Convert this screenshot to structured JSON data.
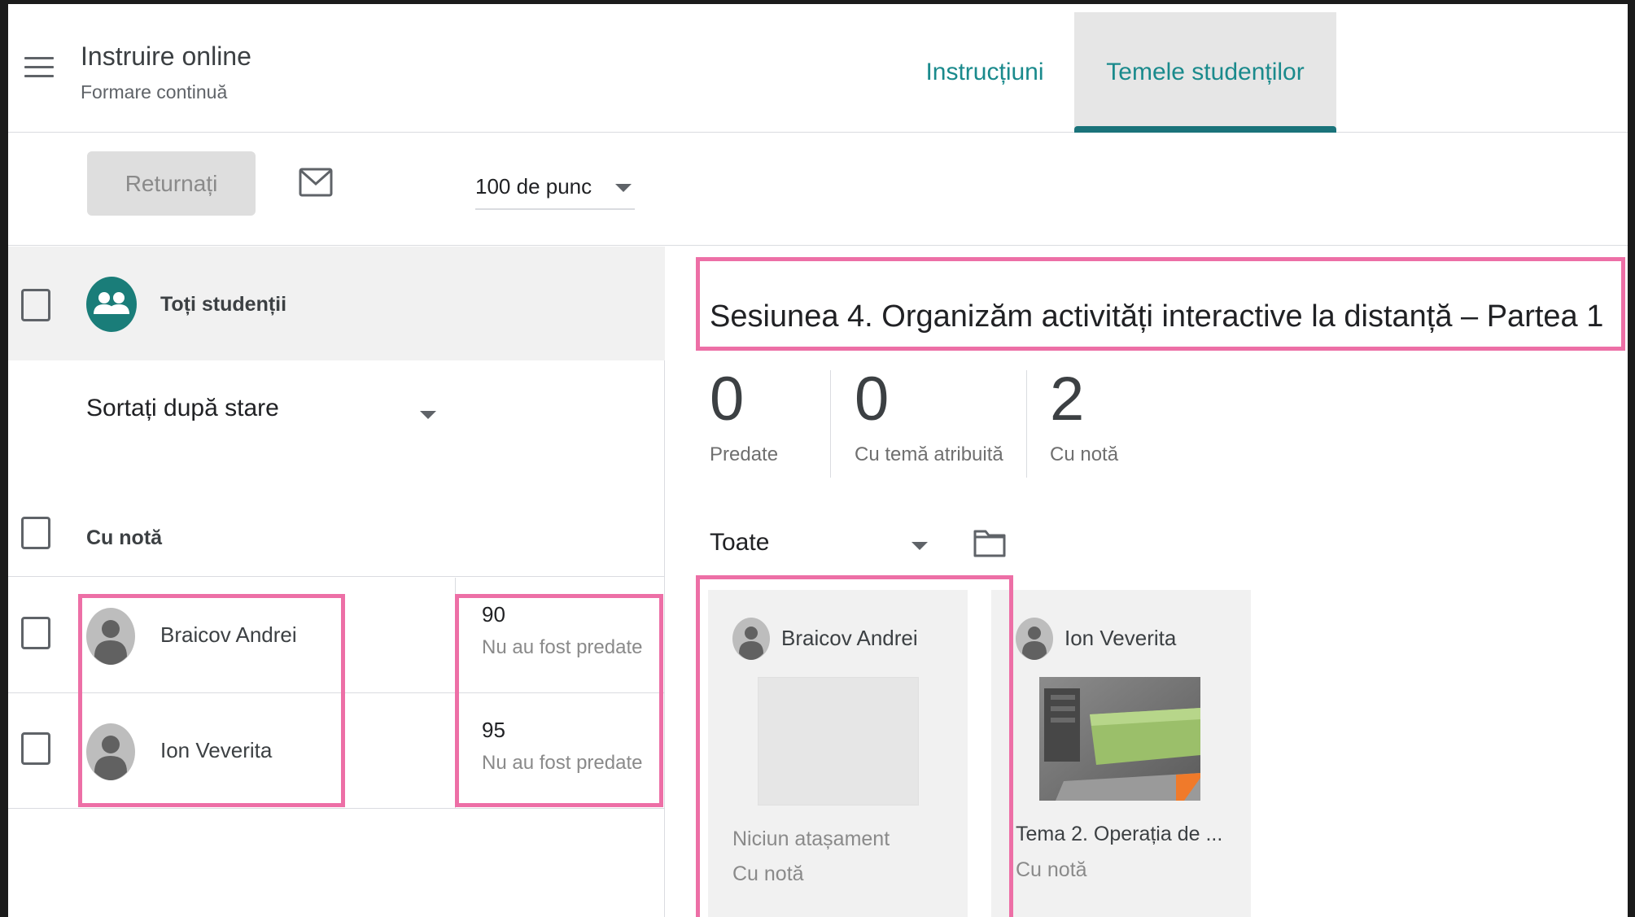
{
  "header": {
    "class_title": "Instruire online",
    "class_subtitle": "Formare continuă",
    "tabs": [
      {
        "label": "Instrucțiuni",
        "active": false
      },
      {
        "label": "Temele studenților",
        "active": true
      }
    ]
  },
  "toolbar": {
    "return_label": "Returnați",
    "points_value": "100 de punc"
  },
  "left_panel": {
    "all_students_label": "Toți studenții",
    "sort_value": "Sortați după stare",
    "group_label": "Cu notă",
    "students": [
      {
        "name": "Braicov Andrei",
        "grade": "90",
        "status": "Nu au fost predate"
      },
      {
        "name": "Ion Veverita",
        "grade": "95",
        "status": "Nu au fost predate"
      }
    ]
  },
  "right_panel": {
    "assignment_title": "Sesiunea 4. Organizăm activități interactive la distanță – Partea 1",
    "stats": [
      {
        "number": "0",
        "label": "Predate"
      },
      {
        "number": "0",
        "label": "Cu temă atribuită"
      },
      {
        "number": "2",
        "label": "Cu notă"
      }
    ],
    "filter_value": "Toate",
    "cards": [
      {
        "name": "Braicov Andrei",
        "attachment": "Niciun atașament",
        "status": "Cu notă"
      },
      {
        "name": "Ion Veverita",
        "attachment": "Tema 2. Operația de ...",
        "status": "Cu notă"
      }
    ]
  },
  "colors": {
    "accent": "#1a8a8c",
    "tab_indicator": "#1a737a",
    "highlight": "#ed6fa6"
  },
  "icons": [
    "menu-icon",
    "mail-icon",
    "group-icon",
    "person-icon",
    "folder-icon",
    "dropdown-arrow-icon"
  ]
}
